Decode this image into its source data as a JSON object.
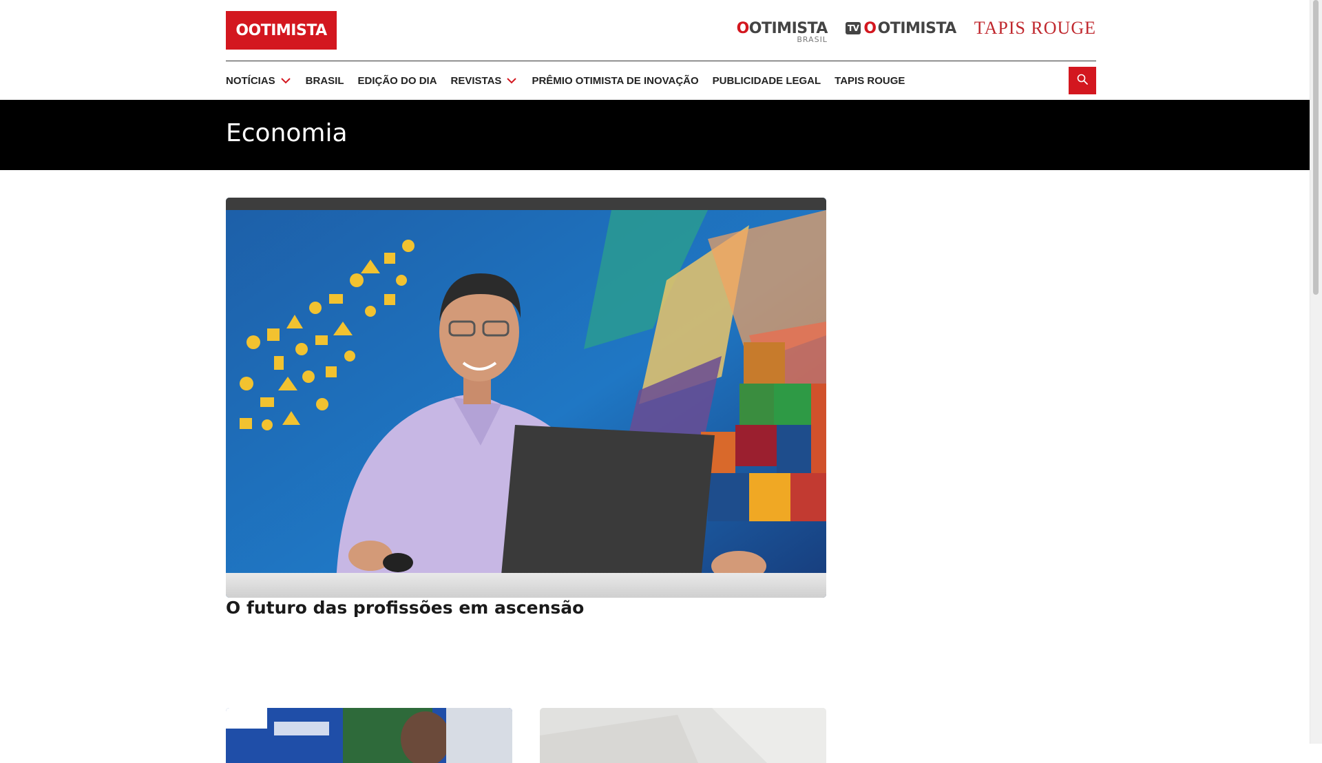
{
  "header": {
    "logo": "OOTIMISTA",
    "brands": {
      "otimista_brasil": {
        "name": "OTIMISTA",
        "sub": "BRASIL"
      },
      "tv_otimista": {
        "tv": "TV",
        "name": "OTIMISTA"
      },
      "tapis_rouge": "TAPIS ROUGE"
    }
  },
  "nav": {
    "items": [
      {
        "label": "NOTÍCIAS",
        "has_dropdown": true
      },
      {
        "label": "BRASIL",
        "has_dropdown": false
      },
      {
        "label": "EDIÇÃO DO DIA",
        "has_dropdown": false
      },
      {
        "label": "REVISTAS",
        "has_dropdown": true
      },
      {
        "label": "PRÊMIO OTIMISTA DE INOVAÇÃO",
        "has_dropdown": false
      },
      {
        "label": "PUBLICIDADE LEGAL",
        "has_dropdown": false
      },
      {
        "label": "TAPIS ROUGE",
        "has_dropdown": false
      }
    ],
    "search_icon": "search-icon"
  },
  "section": {
    "title": "Economia"
  },
  "hero": {
    "title": "O futuro das profissões em ascensão"
  },
  "colors": {
    "accent": "#d3171f",
    "banner": "#000000"
  }
}
